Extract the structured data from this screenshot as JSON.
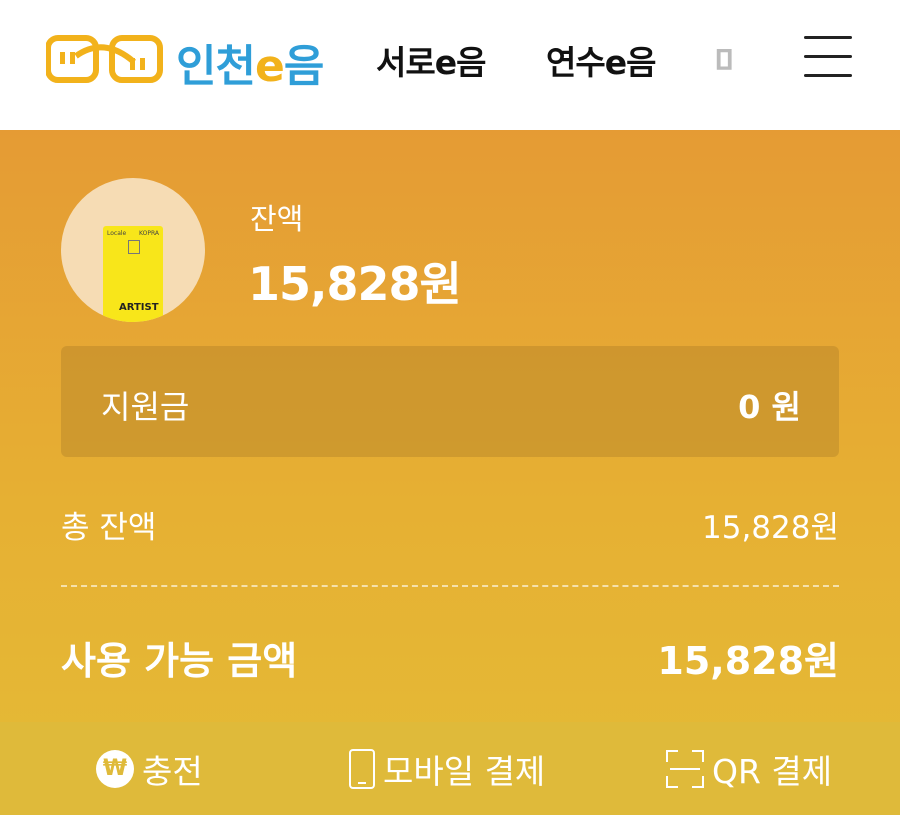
{
  "header": {
    "logo_text_pre": "인천",
    "logo_text_e": "e",
    "logo_text_post": "음",
    "tabs": [
      "서로e음",
      "연수e음",
      "미"
    ],
    "menu_icon": "hamburger-menu-icon"
  },
  "card": {
    "brand_left": "Locale",
    "brand_right": "KOPRA",
    "name": "ARTIST"
  },
  "balance": {
    "label": "잔액",
    "value": "15,828원"
  },
  "subsidy": {
    "label": "지원금",
    "value": "0 원"
  },
  "total": {
    "label": "총 잔액",
    "value": "15,828원"
  },
  "available": {
    "label": "사용 가능 금액",
    "value": "15,828원"
  },
  "actions": {
    "charge_label": "충전",
    "charge_icon_glyph": "₩",
    "mobile_pay_label": "모바일 결제",
    "qr_pay_label": "QR 결제"
  },
  "colors": {
    "panel_top": "#e59b34",
    "panel_bottom": "#e4bb36",
    "action_bar": "#dfba3a",
    "logo_blue": "#2f9ed8",
    "logo_yellow": "#f2b21b"
  }
}
